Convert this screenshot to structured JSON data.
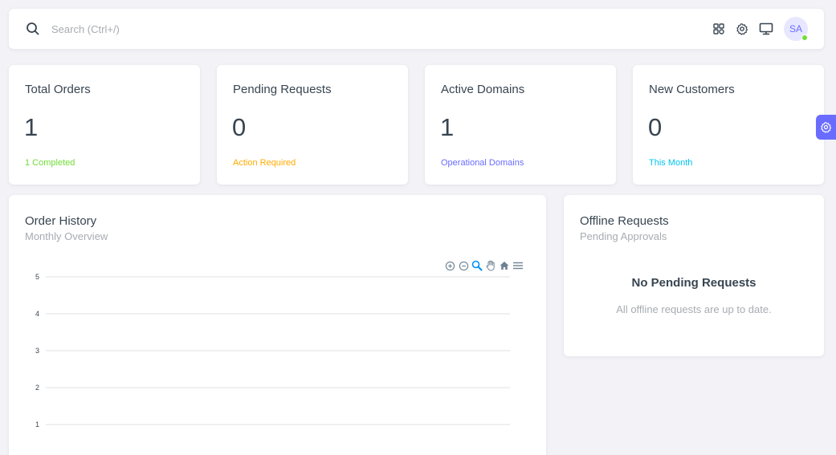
{
  "navbar": {
    "search_placeholder": "Search (Ctrl+/)",
    "icons": [
      "search-icon",
      "grid-icon",
      "gear-icon",
      "monitor-icon"
    ],
    "avatar_initials": "SA",
    "avatar_status": "online"
  },
  "stats": [
    {
      "title": "Total Orders",
      "value": "1",
      "subtitle": "1 Completed",
      "color": "#71dd37"
    },
    {
      "title": "Pending Requests",
      "value": "0",
      "subtitle": "Action Required",
      "color": "#ffab00"
    },
    {
      "title": "Active Domains",
      "value": "1",
      "subtitle": "Operational Domains",
      "color": "#696cff"
    },
    {
      "title": "New Customers",
      "value": "0",
      "subtitle": "This Month",
      "color": "#03c3ec"
    }
  ],
  "order_history": {
    "title": "Order History",
    "subtitle": "Monthly Overview",
    "toolbar": [
      "zoom-in-icon",
      "zoom-out-icon",
      "zoom-selection-icon",
      "pan-hand-icon",
      "home-reset-icon",
      "menu-icon"
    ]
  },
  "offline_requests": {
    "title": "Offline Requests",
    "subtitle": "Pending Approvals",
    "empty_title": "No Pending Requests",
    "empty_text": "All offline requests are up to date."
  },
  "chart_data": {
    "type": "line",
    "y_ticks": [
      1,
      2,
      3,
      4,
      5
    ],
    "ylim": [
      0,
      5
    ],
    "grid": true,
    "series": []
  },
  "colors": {
    "primary": "#696cff",
    "success": "#71dd37",
    "warning": "#ffab00",
    "info": "#03c3ec",
    "background": "#f2f2f7"
  }
}
